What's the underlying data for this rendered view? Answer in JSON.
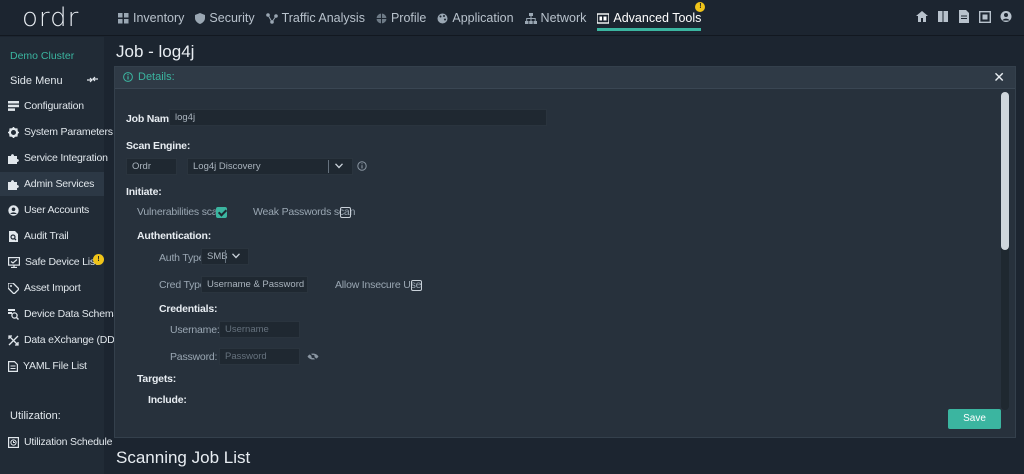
{
  "app": {
    "logo": "ordr"
  },
  "nav": {
    "items": [
      {
        "label": "Inventory",
        "icon": "grid-icon"
      },
      {
        "label": "Security",
        "icon": "shield-icon"
      },
      {
        "label": "Traffic Analysis",
        "icon": "network-nodes-icon"
      },
      {
        "label": "Profile",
        "icon": "globe-icon"
      },
      {
        "label": "Application",
        "icon": "palette-icon"
      },
      {
        "label": "Network",
        "icon": "sitemap-icon"
      },
      {
        "label": "Advanced Tools",
        "icon": "tools-icon",
        "active": true,
        "badge": "!"
      }
    ]
  },
  "sidebar": {
    "cluster": "Demo Cluster",
    "side_menu": "Side Menu",
    "items": [
      {
        "label": "Configuration",
        "icon": "configuration-icon"
      },
      {
        "label": "System Parameters",
        "icon": "gear-icon"
      },
      {
        "label": "Service Integration",
        "icon": "puzzle-icon"
      },
      {
        "label": "Admin Services",
        "icon": "puzzle-icon",
        "active": true
      },
      {
        "label": "User Accounts",
        "icon": "user-circle-icon"
      },
      {
        "label": "Audit Trail",
        "icon": "audit-icon"
      },
      {
        "label": "Safe Device List",
        "icon": "monitor-check-icon",
        "badge": "!"
      },
      {
        "label": "Asset Import",
        "icon": "tag-icon"
      },
      {
        "label": "Device Data Schema",
        "icon": "schema-search-icon"
      },
      {
        "label": "Data eXchange (DDX)",
        "icon": "exchange-icon"
      },
      {
        "label": "YAML File List",
        "icon": "file-icon"
      }
    ],
    "utilization_label": "Utilization:",
    "utilization_item": "Utilization Schedule"
  },
  "page": {
    "title": "Job - log4j",
    "list_title": "Scanning Job List"
  },
  "details": {
    "header": "Details:",
    "job_name_label": "Job Name:",
    "job_name_value": "log4j",
    "scan_engine_label": "Scan Engine:",
    "scan_engine_vendor": "Ordr",
    "scan_engine_value": "Log4j Discovery",
    "initiate_label": "Initiate:",
    "vuln_scan_label": "Vulnerabilities scan",
    "weak_pw_label": "Weak Passwords scan",
    "authentication_label": "Authentication:",
    "auth_type_label": "Auth Type:",
    "auth_type_value": "SMB",
    "cred_type_label": "Cred Type:",
    "cred_type_value": "Username & Password",
    "allow_insecure_label": "Allow Insecure Use",
    "credentials_label": "Credentials:",
    "username_label": "Username:",
    "username_placeholder": "Username",
    "password_label": "Password:",
    "password_placeholder": "Password",
    "targets_label": "Targets:",
    "include_label": "Include:",
    "save_label": "Save"
  },
  "state": {
    "vuln_scan_checked": true,
    "weak_pw_checked": false,
    "allow_insecure_checked": false
  },
  "colors": {
    "accent": "#3bb5a0",
    "badge": "#f0c419",
    "background": "#1c2530"
  }
}
